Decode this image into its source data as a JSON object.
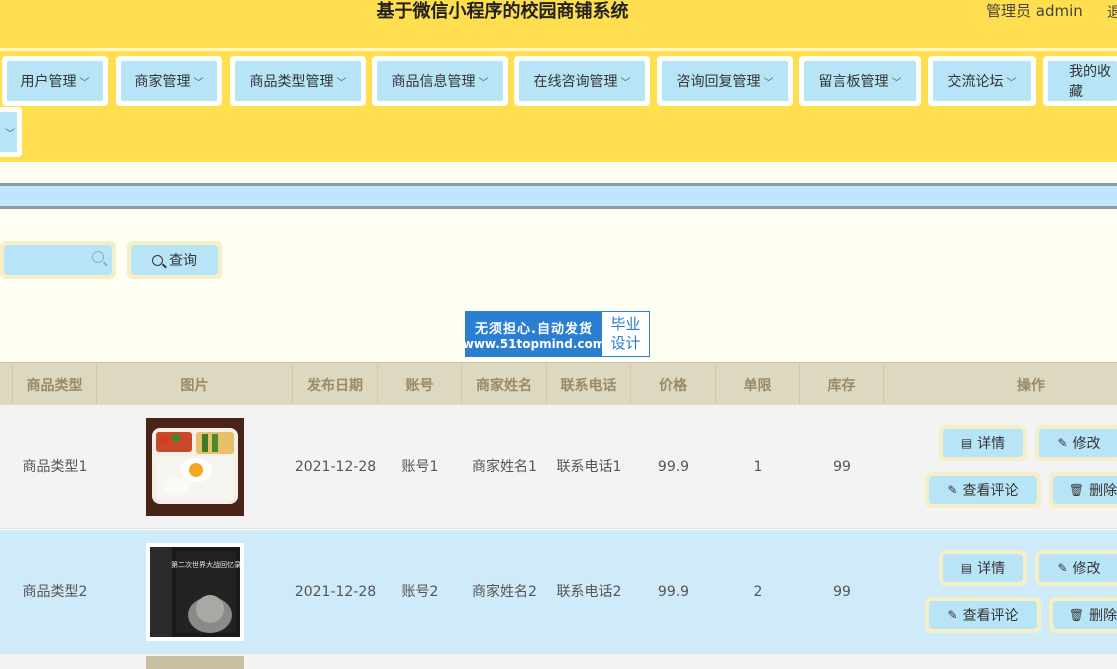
{
  "header": {
    "title": "基于微信小程序的校园商铺系统",
    "admin": "管理员 admin",
    "exit": "退"
  },
  "nav": {
    "items": [
      {
        "label": "用户管理"
      },
      {
        "label": "商家管理"
      },
      {
        "label": "商品类型管理"
      },
      {
        "label": "商品信息管理"
      },
      {
        "label": "在线咨询管理"
      },
      {
        "label": "咨询回复管理"
      },
      {
        "label": "留言板管理"
      },
      {
        "label": "交流论坛"
      },
      {
        "label": "我的收藏"
      }
    ],
    "chevron": "﹀"
  },
  "search": {
    "placeholder": "",
    "button_label": "查询"
  },
  "watermark": {
    "line1": "无须担心.自动发货",
    "line2": "www.51topmind.com",
    "right1": "毕业",
    "right2": "设计"
  },
  "table": {
    "headers": [
      "商品类型",
      "图片",
      "发布日期",
      "账号",
      "商家姓名",
      "联系电话",
      "价格",
      "单限",
      "库存",
      "操作"
    ],
    "rows": [
      {
        "type": "商品类型1",
        "date": "2021-12-28",
        "account": "账号1",
        "merchant": "商家姓名1",
        "phone": "联系电话1",
        "price": "99.9",
        "limit": "1",
        "stock": "99",
        "image": "bento-lunch-photo"
      },
      {
        "type": "商品类型2",
        "date": "2021-12-28",
        "account": "账号2",
        "merchant": "商家姓名2",
        "phone": "联系电话2",
        "price": "99.9",
        "limit": "2",
        "stock": "99",
        "image": "book-cover-photo",
        "book_text": "第二次世界大战回忆录"
      }
    ],
    "actions": {
      "detail": "详情",
      "edit": "修改",
      "comments": "查看评论",
      "delete": "删除"
    }
  },
  "colors": {
    "header_bg": "#ffde4f",
    "button_bg": "#b8e4f8",
    "row_highlight": "#cfeaf8",
    "page_bg": "#fffef3",
    "watermark_blue": "#2a7fd0"
  }
}
